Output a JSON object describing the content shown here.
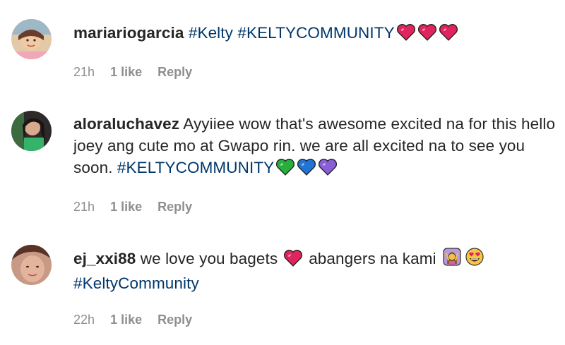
{
  "comments": [
    {
      "username": "mariariogarcia",
      "text_segments": [
        {
          "text": "#Kelty",
          "type": "hashtag"
        },
        {
          "text": " ",
          "type": "text"
        },
        {
          "text": "#KELTYCOMMUNITY",
          "type": "hashtag"
        }
      ],
      "emojis": [
        "red-heart",
        "red-heart",
        "red-heart"
      ],
      "time": "21h",
      "likes": "1 like",
      "reply": "Reply"
    },
    {
      "username": "aloraluchavez",
      "text": "Ayyiiee wow that's awesome excited na for this hello joey ang cute mo at Gwapo rin. we are all excited na to see you soon.",
      "hashtag": "#KELTYCOMMUNITY",
      "emojis": [
        "green-heart",
        "blue-heart",
        "purple-heart"
      ],
      "time": "21h",
      "likes": "1 like",
      "reply": "Reply"
    },
    {
      "username": "ej_xxi88",
      "text_before": "we love you bagets",
      "text_after": "abangers na kami",
      "hashtag": "#KeltyCommunity",
      "emojis": [
        "red-heart",
        "woman-gesturing-emoji",
        "heart-eyes-emoji"
      ],
      "time": "22h",
      "likes": "1 like",
      "reply": "Reply"
    }
  ],
  "colors": {
    "text": "#262626",
    "hashtag": "#00376b",
    "meta": "#8e8e8e",
    "red_heart": "#e0245e",
    "green_heart": "#27ae3e",
    "blue_heart": "#1f74d6",
    "purple_heart": "#8a5ed6"
  }
}
